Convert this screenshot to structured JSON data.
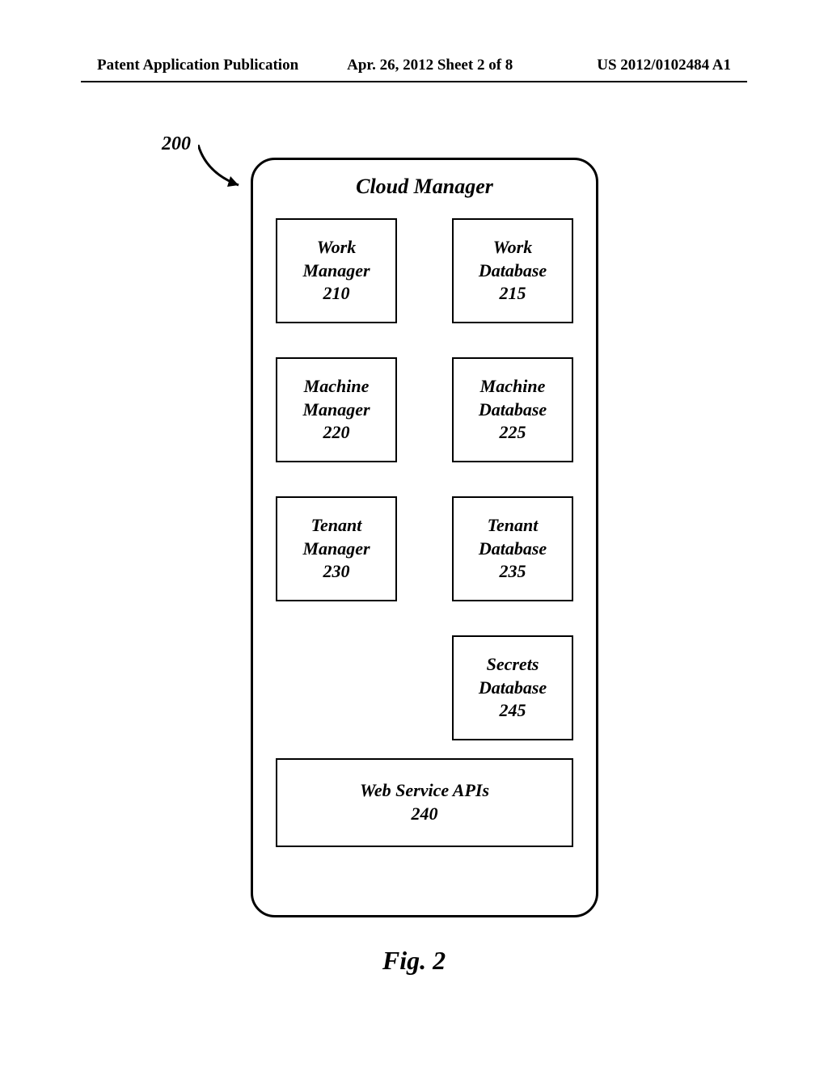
{
  "header": {
    "left": "Patent Application Publication",
    "center": "Apr. 26, 2012  Sheet 2 of 8",
    "right": "US 2012/0102484 A1"
  },
  "diagram": {
    "ref_num": "200",
    "title": "Cloud Manager",
    "boxes": {
      "work_manager": {
        "l1": "Work",
        "l2": "Manager",
        "l3": "210"
      },
      "work_database": {
        "l1": "Work",
        "l2": "Database",
        "l3": "215"
      },
      "machine_manager": {
        "l1": "Machine",
        "l2": "Manager",
        "l3": "220"
      },
      "machine_database": {
        "l1": "Machine",
        "l2": "Database",
        "l3": "225"
      },
      "tenant_manager": {
        "l1": "Tenant",
        "l2": "Manager",
        "l3": "230"
      },
      "tenant_database": {
        "l1": "Tenant",
        "l2": "Database",
        "l3": "235"
      },
      "secrets_database": {
        "l1": "Secrets",
        "l2": "Database",
        "l3": "245"
      },
      "web_service_apis": {
        "l1": "Web Service APIs",
        "l2": "240"
      }
    }
  },
  "figure_label": "Fig. 2"
}
